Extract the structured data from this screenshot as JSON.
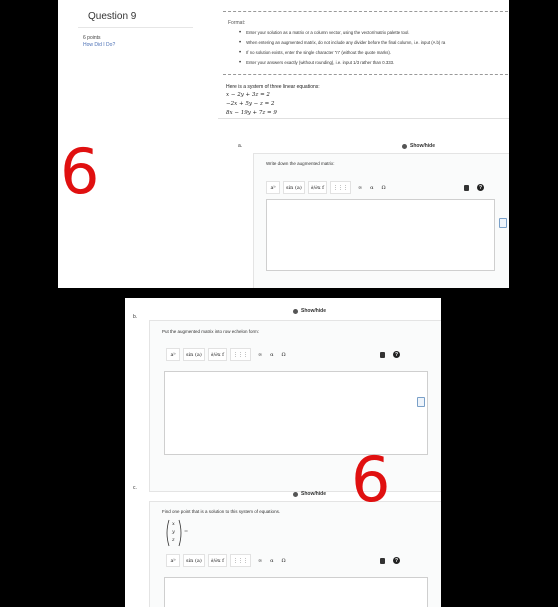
{
  "question": {
    "title": "Question 9",
    "points": "6 points",
    "how_did_i_do": "How Did I Do?"
  },
  "format": {
    "title": "Format:",
    "items": [
      "Enter your solution as a matrix or a column vector, using the vector/matrix palette tool.",
      "When entering an augmented matrix, do not include any divider before the final column, i.e. input (A b) ra",
      "If no solution exists, enter the single character \"n\" (without the quote marks).",
      "Enter your answers exactly (without rounding), i.e. input 1/3 rather than 0.333."
    ]
  },
  "system": {
    "intro": "Here is a system of three linear equations:",
    "equations": [
      "x − 2y + 3z = 2",
      "−2x + 5y − z = 2",
      "8x − 19y + 7z = 9"
    ]
  },
  "parts": [
    {
      "letter": "a.",
      "prompt": "Write down the augmented matrix:",
      "showhide": "Show/hide"
    },
    {
      "letter": "b.",
      "prompt": "Put the augmented matrix into row echelon form:",
      "showhide": "Show/hide"
    },
    {
      "letter": "c.",
      "prompt": "Find one point that is a solution to this system of equations.",
      "showhide": "Show/hide"
    }
  ],
  "toolbar": {
    "power": "aᵇ",
    "sin": "sin (a)",
    "deriv": "∂/∂x f",
    "matrix": "⋮⋮⋮",
    "infinity": "∞",
    "alpha": "α",
    "omega": "Ω",
    "help": "?"
  },
  "vector_c": {
    "x": "x",
    "y": "y",
    "z": "z",
    "equals": "="
  },
  "annotations": {
    "top": "6",
    "bottom": "6"
  }
}
